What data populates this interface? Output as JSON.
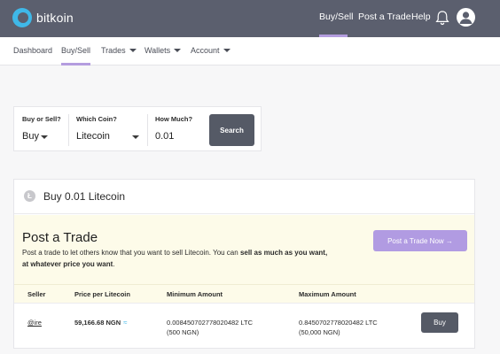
{
  "app": {
    "brand": "bitkoin"
  },
  "topnav": {
    "items": [
      {
        "label": "Buy/Sell",
        "active": true
      },
      {
        "label": "Post a Trade"
      },
      {
        "label": "Help"
      }
    ],
    "icons": [
      "bell-icon",
      "user-avatar-icon"
    ]
  },
  "subnav": {
    "items": [
      {
        "label": "Dashboard"
      },
      {
        "label": "Buy/Sell",
        "active": true
      },
      {
        "label": "Trades",
        "dropdown": true
      },
      {
        "label": "Wallets",
        "dropdown": true
      },
      {
        "label": "Account",
        "dropdown": true
      }
    ]
  },
  "search": {
    "buy_or_sell_label": "Buy or Sell?",
    "buy_or_sell_value": "Buy",
    "coin_label": "Which Coin?",
    "coin_value": "Litecoin",
    "amount_label": "How Much?",
    "amount_value": "0.01",
    "search_button": "Search"
  },
  "listing": {
    "coin_icon": "Ł",
    "title": "Buy 0.01 Litecoin",
    "post": {
      "heading": "Post a Trade",
      "desc_text": "Post a trade to let others know that you want to sell Litecoin. You can ",
      "desc_bold": "sell as much as you want, at whatever price you want",
      "desc_end": ".",
      "button": "Post a Trade Now →"
    },
    "columns": [
      "Seller",
      "Price per Litecoin",
      "Minimum Amount",
      "Maximum Amount"
    ],
    "rows": [
      {
        "seller": "@ire",
        "price": "59,166.68 NGN",
        "min_amount": "0.008450702778020482 LTC",
        "min_fiat": "(500 NGN)",
        "max_amount": "0.8450702778020482 LTC",
        "max_fiat": "(50,000 NGN)",
        "action": "Buy"
      }
    ]
  },
  "colors": {
    "topbar": "#5b5f6e",
    "accent": "#b49ddf",
    "post_button": "#b19be2",
    "dark_button": "#555a66",
    "highlight_bg": "#fdfbe9",
    "logo": "#3fb8e8"
  }
}
